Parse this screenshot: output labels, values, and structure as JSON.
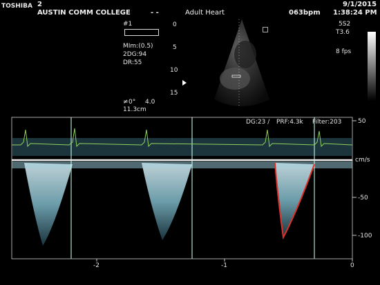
{
  "header": {
    "brand": "TOSHIBA",
    "patient_number": "2",
    "institution": "AUSTIN COMM COLLEGE",
    "separator": "- -",
    "exam": "Adult Heart",
    "heart_rate": "063bpm",
    "date": "9/1/2015",
    "time": "1:38:24 PM"
  },
  "left_panel": {
    "marker": "#1",
    "mi": "MIm:(0.5)",
    "twod_gain": "2DG:94",
    "dynamic_range": "DR:55",
    "angle": "0°",
    "angle_value": "4.0",
    "depth_cm": "11.3cm"
  },
  "depth_scale": [
    "0",
    "5",
    "10",
    "15"
  ],
  "right_panel": {
    "probe": "5S2",
    "thermal_index": "T3.6",
    "frame_rate": "8 fps"
  },
  "doppler": {
    "params": {
      "gain": "DG:23 /",
      "prf": "PRF:4.3k",
      "filter": "Filter:203"
    },
    "velocity_unit": "cm/s",
    "velocity_ticks": [
      "50",
      "-50",
      "-100"
    ],
    "time_ticks": [
      "-2",
      "-1",
      "0"
    ]
  },
  "colors": {
    "background": "#000000",
    "text": "#e6e6e6",
    "ecg": "#8fd35a",
    "trace": "#e0302a",
    "spectrum": "#b8e4ef"
  }
}
